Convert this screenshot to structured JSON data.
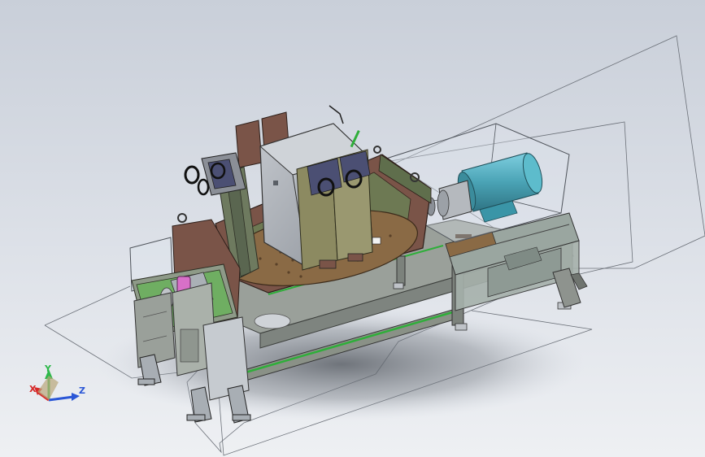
{
  "viewport": {
    "background_top": "#c9cfd9",
    "background_bottom": "#eef0f3"
  },
  "model": {
    "frame_color": "#8a9187",
    "panel_color": "#7a5448",
    "platform_color": "#8a6a45",
    "housing_color": "#a9aeb5",
    "plate_color": "#8c8a61",
    "motor_color": "#4aa3b5",
    "accent_green": "#2fae3a",
    "pink_part": "#d870c8"
  },
  "triad": {
    "x_label": "X",
    "y_label": "Y",
    "z_label": "Z",
    "x_color": "#d62828",
    "y_color": "#2db84a",
    "z_color": "#2a56d6"
  }
}
